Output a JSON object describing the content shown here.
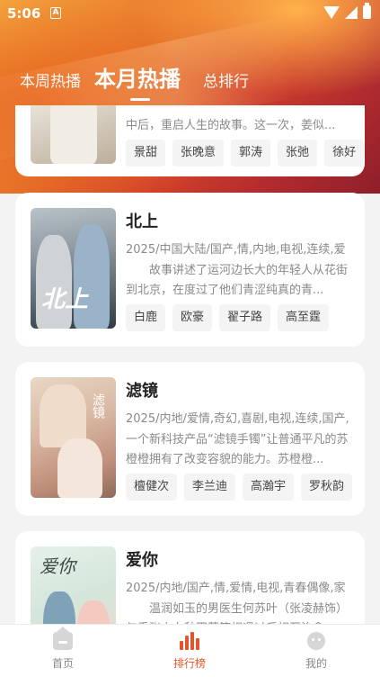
{
  "status_bar": {
    "time": "5:06",
    "notification_icon": "a-box-icon",
    "icons": [
      "wifi-icon",
      "signal-icon",
      "battery-charging-icon"
    ]
  },
  "tabs": [
    {
      "label": "本周热播",
      "active": false
    },
    {
      "label": "本月热播",
      "active": true
    },
    {
      "label": "总排行",
      "active": false
    }
  ],
  "dramas": [
    {
      "title": "",
      "meta": "",
      "description": "中后，重启人生的故事。这一次，姜似...",
      "actors": [
        "景甜",
        "张晚意",
        "郭涛",
        "张弛",
        "徐好"
      ]
    },
    {
      "title": "北上",
      "poster_text": "北上",
      "meta": "2025/中国大陆/国产,情,内地,电视,连续,爱",
      "description": "故事讲述了运河边长大的年轻人从花街到北京，在度过了他们青涩纯真的青...",
      "actors": [
        "白鹿",
        "欧豪",
        "翟子路",
        "高至霆"
      ]
    },
    {
      "title": "滤镜",
      "poster_text": "滤镜",
      "meta": "2025/内地/爱情,奇幻,喜剧,电视,连续,国产,",
      "description": "一个新科技产品“滤镜手镯”让普通平凡的苏橙橙拥有了改变容貌的能力。苏橙橙...",
      "actors": [
        "檀健次",
        "李兰迪",
        "高瀚宇",
        "罗秋韵"
      ]
    },
    {
      "title": "爱你",
      "poster_text": "爱你",
      "meta": "2025/内地/国产,情,爱情,电视,青春偶像,家",
      "description": "温润如玉的男医生何苏叶（张凌赫饰）与乖张少女秋田菜等相遇过后相互治愈...",
      "actors": []
    }
  ],
  "bottom_nav": [
    {
      "label": "首页",
      "icon": "home-icon",
      "active": false
    },
    {
      "label": "排行榜",
      "icon": "bar-chart-icon",
      "active": true
    },
    {
      "label": "我的",
      "icon": "smiley-face-icon",
      "active": false
    }
  ],
  "colors": {
    "accent": "#e3552d",
    "hero_start": "#f3a23c",
    "hero_end": "#8e1f2a"
  }
}
